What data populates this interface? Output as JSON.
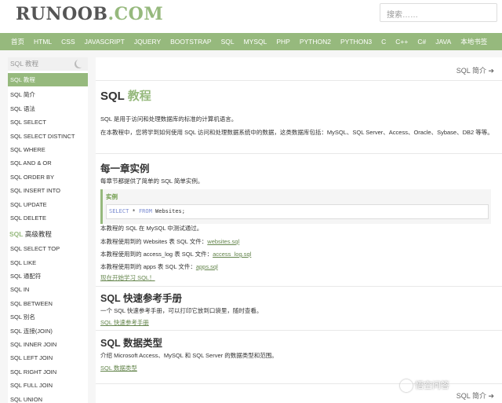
{
  "header": {
    "logo_main": "RUNOOB",
    "logo_tld": ".COM",
    "search_placeholder": "搜索……"
  },
  "nav": [
    "首页",
    "HTML",
    "CSS",
    "JAVASCRIPT",
    "JQUERY",
    "BOOTSTRAP",
    "SQL",
    "MYSQL",
    "PHP",
    "PYTHON2",
    "PYTHON3",
    "C",
    "C++",
    "C#",
    "JAVA",
    "本地书签"
  ],
  "sidebar": {
    "title": "SQL 教程",
    "items": [
      "SQL 教程",
      "SQL 简介",
      "SQL 语法",
      "SQL SELECT",
      "SQL SELECT DISTINCT",
      "SQL WHERE",
      "SQL AND & OR",
      "SQL ORDER BY",
      "SQL INSERT INTO",
      "SQL UPDATE",
      "SQL DELETE"
    ],
    "group_prefix": "SQL",
    "group_title": " 高级教程",
    "advanced": [
      "SQL SELECT TOP",
      "SQL LIKE",
      "SQL 通配符",
      "SQL IN",
      "SQL BETWEEN",
      "SQL 别名",
      "SQL 连接(JOIN)",
      "SQL INNER JOIN",
      "SQL LEFT JOIN",
      "SQL RIGHT JOIN",
      "SQL FULL JOIN",
      "SQL UNION"
    ]
  },
  "main": {
    "next_link": "SQL 简介 ➔",
    "title_prefix": "SQL ",
    "title_suffix": "教程",
    "intro1": "SQL 是用于访问和处理数据库的标准的计算机语言。",
    "intro2": "在本教程中，您将学到如何使用 SQL 访问和处理数据系统中的数据，这类数据库包括：MySQL、SQL Server、Access、Oracle、Sybase、DB2 等等。",
    "h_examples": "每一章实例",
    "examples_desc": "每章节都提供了简单的 SQL 简单实例。",
    "example_label": "实例",
    "code_kw1": "SELECT",
    "code_mid": " * ",
    "code_kw2": "FROM",
    "code_table": " Websites;",
    "p_mysql": "本教程的 SQL 在 MySQL 中测试通过。",
    "p_websites_pre": "本教程使用到的 Websites 表 SQL 文件：",
    "p_websites_link": "websites.sql",
    "p_accesslog_pre": "本教程使用到的 access_log 表 SQL 文件：",
    "p_accesslog_link": "access_log.sql",
    "p_apps_pre": "本教程使用到的 apps 表 SQL 文件：",
    "p_apps_link": "apps.sql",
    "start_link": "现在开始学习 SQL！",
    "h_quickref": "SQL 快速参考手册",
    "quickref_desc": "一个 SQL 快速参考手册，可以打印它放到口袋里，随时查看。",
    "quickref_link": "SQL 快速参考手册",
    "h_datatypes": "SQL 数据类型",
    "datatypes_desc": "介绍 Microsoft Access、MySQL 和 SQL Server 的数据类型和范围。",
    "datatypes_link": "SQL 数据类型",
    "next_link_bottom": "SQL 简介 ➔"
  },
  "watermark": "悟空问答"
}
